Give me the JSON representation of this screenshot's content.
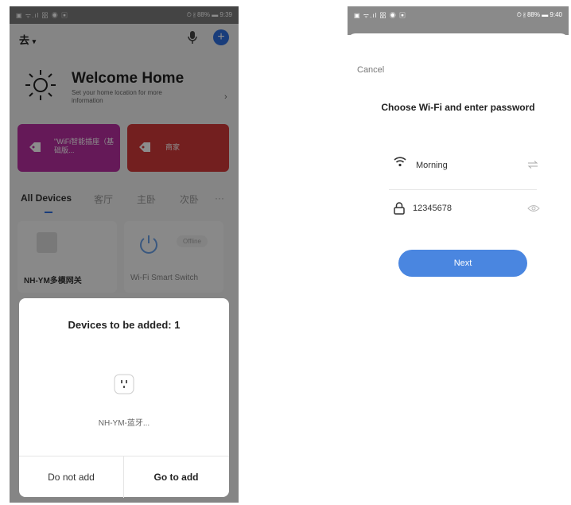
{
  "left_phone": {
    "status_bar": {
      "left": "▣ ᯤ.ıl 㗊 ◉ ▣",
      "right": "⏱ ∦ 88% ▬ 9:39"
    },
    "home_bar": {
      "name": "去",
      "dropdown_icon": "chevron-down-icon",
      "mic_icon": "mic-icon",
      "add_label": "+"
    },
    "welcome": {
      "title": "Welcome Home",
      "subtitle": "Set your home location for more information",
      "chevron": "›"
    },
    "cards": [
      {
        "label": "\"WiFi智能插座（基础版...",
        "icon": "tag-icon",
        "color": "#b82fa0"
      },
      {
        "label": "商家",
        "icon": "tag-icon",
        "color": "#d23a3a"
      }
    ],
    "tabs": [
      {
        "label": "All Devices",
        "active": true
      },
      {
        "label": "客厅"
      },
      {
        "label": "主卧"
      },
      {
        "label": "次卧"
      },
      {
        "label": "···"
      }
    ],
    "devices": [
      {
        "name": "NH-YM多模网关"
      },
      {
        "name": "Wi-Fi Smart Switch",
        "status": "Offline"
      }
    ],
    "dialog": {
      "title": "Devices to be added: 1",
      "device_name": "NH-YM-蓝牙...",
      "device_icon": "plug-icon",
      "btn_no": "Do not add",
      "btn_go": "Go to add"
    }
  },
  "right_phone": {
    "status_bar": {
      "left": "▣ ᯤ.ıl 㗊 ◉ ▣",
      "right": "⏱ ∦ 88% ▬ 9:40"
    },
    "cancel": "Cancel",
    "title": "Choose Wi-Fi and enter password",
    "ssid": "Morning",
    "password": "12345678",
    "next": "Next",
    "accent": "#4a86e0"
  }
}
